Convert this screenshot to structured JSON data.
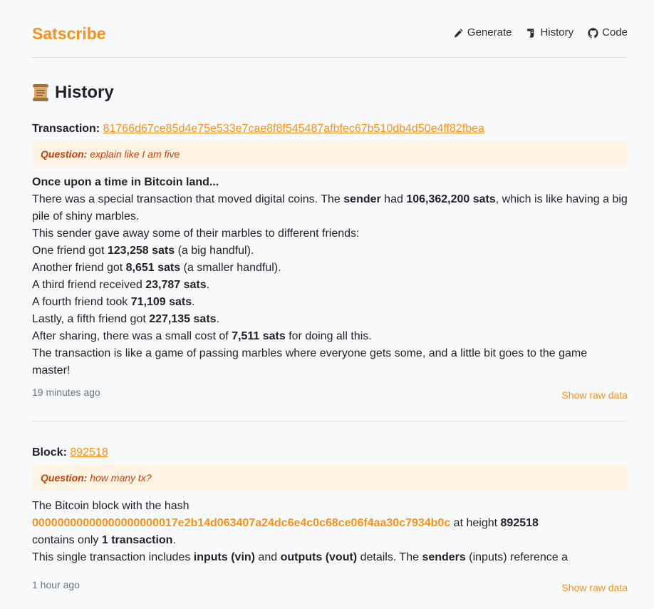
{
  "header": {
    "brand": "Satscribe",
    "nav": [
      {
        "label": "Generate",
        "icon": "pencil-icon"
      },
      {
        "label": "History",
        "icon": "scroll-icon"
      },
      {
        "label": "Code",
        "icon": "github-icon"
      }
    ]
  },
  "page": {
    "title": "History",
    "title_icon": "scroll-icon"
  },
  "entries": [
    {
      "label": "Transaction:",
      "id": "81766d67ce85d4e75e533e7cae8f8f545487afbfec67b510db4d50e4ff82fbea",
      "question_label": "Question:",
      "question": "explain like I am five",
      "heading": "Once upon a time in Bitcoin land...",
      "lines": {
        "l1a": "There was a special transaction that moved digital coins. The ",
        "l1b": "sender",
        "l1c": " had ",
        "l1d": "106,362,200 sats",
        "l1e": ", which is like having a big pile of shiny marbles.",
        "l2": "This sender gave away some of their marbles to different friends:",
        "l3a": "One friend got ",
        "l3b": "123,258 sats",
        "l3c": " (a big handful).",
        "l4a": "Another friend got ",
        "l4b": "8,651 sats",
        "l4c": " (a smaller handful).",
        "l5a": "A third friend received ",
        "l5b": "23,787 sats",
        "l5c": ".",
        "l6a": "A fourth friend took ",
        "l6b": "71,109 sats",
        "l6c": ".",
        "l7a": "Lastly, a fifth friend got ",
        "l7b": "227,135 sats",
        "l7c": ".",
        "l8a": "After sharing, there was a small cost of ",
        "l8b": "7,511 sats",
        "l8c": " for doing all this.",
        "l9": "The transaction is like a game of passing marbles where everyone gets some, and a little bit goes to the game master!"
      },
      "timestamp": "19 minutes ago",
      "raw_link": "Show raw data"
    },
    {
      "label": "Block:",
      "id": "892518",
      "question_label": "Question:",
      "question": "how many tx?",
      "lines": {
        "l1": "The Bitcoin block with the hash",
        "l2a": "00000000000000000000017e2b14d063407a24dc6e4c0c68ce06f4aa30c7934b0c",
        "l2b": " at height ",
        "l2c": "892518",
        "l3a": "contains only ",
        "l3b": "1 transaction",
        "l3c": ".",
        "l4a": "This single transaction includes ",
        "l4b": "inputs (vin)",
        "l4c": " and ",
        "l4d": "outputs (vout)",
        "l4e": " details. The ",
        "l4f": "senders",
        "l4g": " (inputs) reference a"
      },
      "timestamp": "1 hour ago",
      "raw_link": "Show raw data"
    }
  ]
}
